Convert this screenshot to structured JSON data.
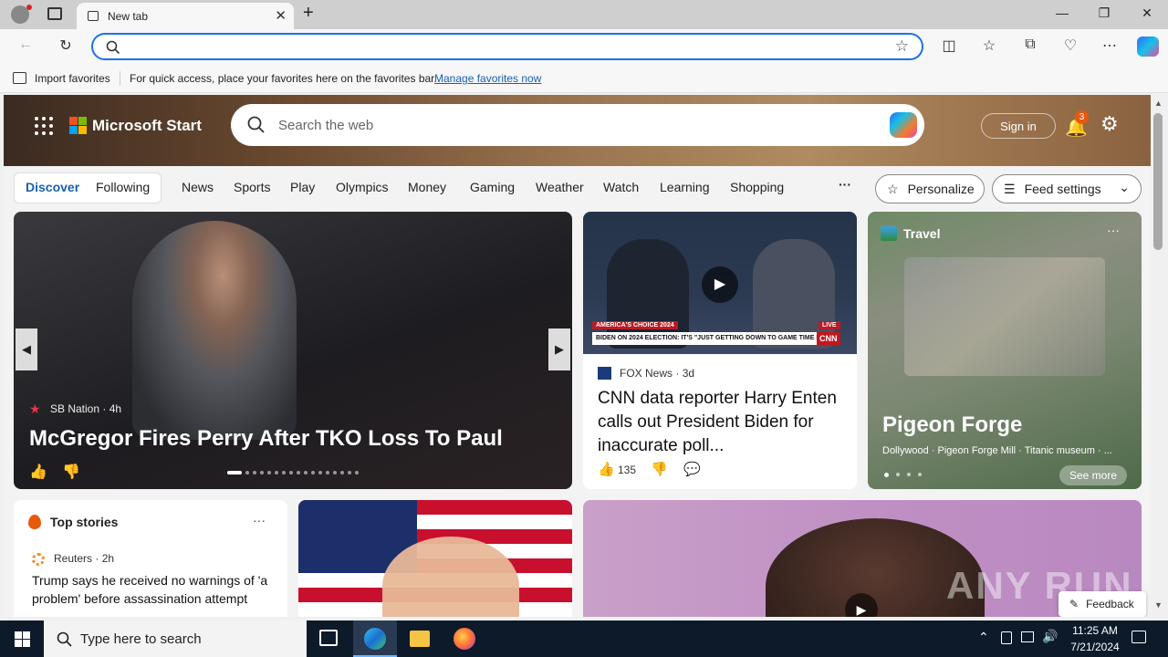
{
  "browser": {
    "tab_title": "New tab",
    "favbar_import": "Import favorites",
    "favbar_text": "For quick access, place your favorites here on the favorites bar.",
    "favbar_link": "Manage favorites now"
  },
  "header": {
    "brand": "Microsoft Start",
    "search_placeholder": "Search the web",
    "signin": "Sign in",
    "notif_count": "3"
  },
  "nav": {
    "discover": "Discover",
    "following": "Following",
    "items": [
      "News",
      "Sports",
      "Play",
      "Olympics",
      "Money",
      "Gaming",
      "Weather",
      "Watch",
      "Learning",
      "Shopping"
    ],
    "more": "···",
    "personalize": "Personalize",
    "feed_settings": "Feed settings"
  },
  "hero": {
    "source": "SB Nation",
    "time": "4h",
    "title": "McGregor Fires Perry After TKO Loss To Paul"
  },
  "video_card": {
    "tv_banner": "AMERICA'S CHOICE 2024",
    "tv_ticker": "BIDEN ON 2024 ELECTION: IT'S \"JUST GETTING DOWN TO GAME TIME NOW\"",
    "tv_live": "LIVE",
    "tv_logo": "CNN",
    "source": "FOX News",
    "time": "3d",
    "title": "CNN data reporter Harry Enten calls out President Biden for inaccurate poll...",
    "likes": "135"
  },
  "travel": {
    "label": "Travel",
    "title": "Pigeon Forge",
    "subtitle": "Dollywood · Pigeon Forge Mill · Titanic museum · ...",
    "see_more": "See more"
  },
  "top_stories": {
    "title": "Top stories",
    "source": "Reuters",
    "time": "2h",
    "headline": "Trump says he received no warnings of 'a problem' before assassination attempt"
  },
  "watermark": "ANY RUN",
  "feedback": "Feedback",
  "taskbar": {
    "search_placeholder": "Type here to search",
    "time": "11:25 AM",
    "date": "7/21/2024"
  }
}
